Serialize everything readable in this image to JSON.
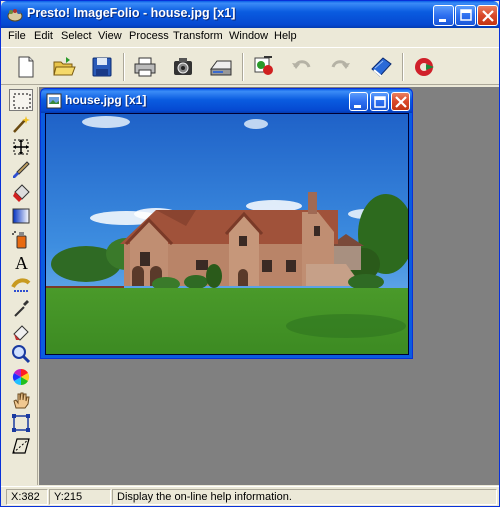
{
  "window": {
    "title": "Presto! ImageFolio - house.jpg [x1]"
  },
  "menu": [
    "File",
    "Edit",
    "Select",
    "View",
    "Process",
    "Transform",
    "Window",
    "Help"
  ],
  "toolbar_buttons": [
    "new-document-icon",
    "open-folder-icon",
    "save-disk-icon",
    "print-icon",
    "acquire-camera-icon",
    "scanner-icon",
    "effects-icon",
    "undo-icon",
    "redo-icon",
    "help-book-icon",
    "exit-icon"
  ],
  "tools": [
    "rectangle-select-icon",
    "magic-wand-icon",
    "move-icon",
    "brush-icon",
    "fill-bucket-icon",
    "gradient-icon",
    "spray-can-icon",
    "text-tool-icon",
    "clone-stamp-icon",
    "eyedropper-icon",
    "eraser-icon",
    "zoom-icon",
    "color-wheel-icon",
    "hand-pan-icon",
    "crop-icon",
    "skew-icon"
  ],
  "document": {
    "title": "house.jpg [x1]"
  },
  "status": {
    "x": "X:382",
    "y": "Y:215",
    "message": "Display the on-line help information."
  },
  "colors": {
    "title_blue": "#0a5ce0",
    "workspace_gray": "#808080",
    "face": "#ece9d8"
  }
}
